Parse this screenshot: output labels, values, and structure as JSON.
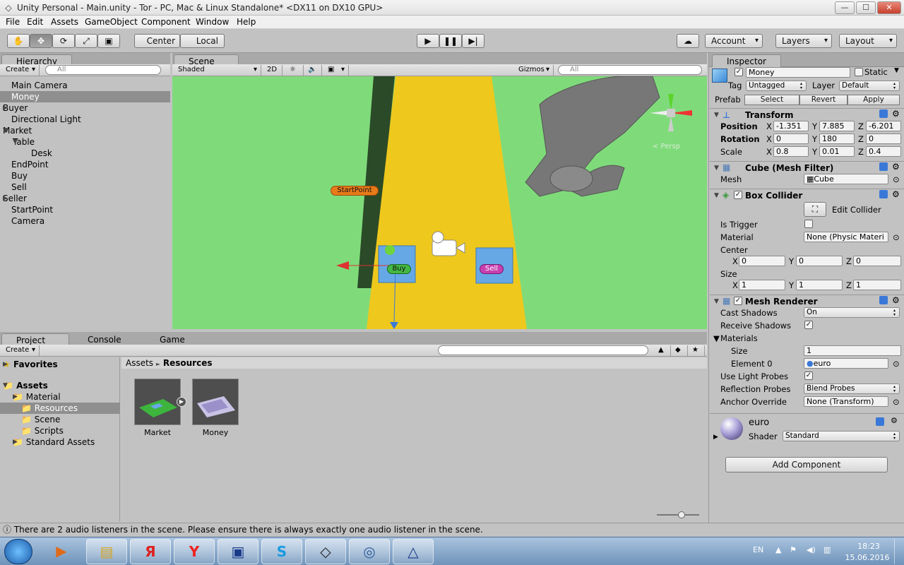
{
  "window": {
    "title": "Unity Personal - Main.unity - Tor - PC, Mac & Linux Standalone* <DX11 on DX10 GPU>",
    "min": "—",
    "max": "☐",
    "close": "✕"
  },
  "menu": [
    "File",
    "Edit",
    "Assets",
    "GameObject",
    "Component",
    "Window",
    "Help"
  ],
  "toolbar": {
    "pivot": "Center",
    "space": "Local",
    "account": "Account",
    "layers": "Layers",
    "layout": "Layout",
    "cloud": "☁"
  },
  "hierarchy": {
    "tab": "Hierarchy",
    "create": "Create",
    "search": "All",
    "items": [
      "Main Camera",
      "Money",
      "Buyer",
      "Directional Light",
      "Market",
      "Table",
      "Desk",
      "EndPoint",
      "Buy",
      "Sell",
      "Seller",
      "StartPoint",
      "Camera"
    ]
  },
  "scene": {
    "tab": "Scene",
    "shading": "Shaded",
    "mode2d": "2D",
    "gizmos": "Gizmos",
    "search": "All",
    "labels": {
      "start": "StartPoint",
      "buy": "Buy",
      "sell": "Sell",
      "persp": "< Persp"
    }
  },
  "project": {
    "tab": "Project",
    "console": "Console",
    "game": "Game",
    "create": "Create",
    "favorites": "Favorites",
    "assets": "Assets",
    "folders": [
      "Material",
      "Resources",
      "Scene",
      "Scripts",
      "Standard Assets"
    ],
    "breadcrumb": {
      "root": "Assets",
      "sep": "►",
      "current": "Resources"
    },
    "items": [
      "Market",
      "Money"
    ]
  },
  "inspector": {
    "tab": "Inspector",
    "name": "Money",
    "static": "Static",
    "tag_label": "Tag",
    "tag": "Untagged",
    "layer_label": "Layer",
    "layer": "Default",
    "prefab": "Prefab",
    "select": "Select",
    "revert": "Revert",
    "apply": "Apply",
    "transform": {
      "title": "Transform",
      "pos": "Position",
      "rot": "Rotation",
      "scale": "Scale",
      "pos_x": "-1.351",
      "pos_y": "7.885",
      "pos_z": "-6.201",
      "rot_x": "0",
      "rot_y": "180",
      "rot_z": "0",
      "sc_x": "0.8",
      "sc_y": "0.01",
      "sc_z": "0.4"
    },
    "meshfilter": {
      "title": "Cube (Mesh Filter)",
      "mesh_label": "Mesh",
      "mesh": "Cube"
    },
    "collider": {
      "title": "Box Collider",
      "edit": "Edit Collider",
      "trigger": "Is Trigger",
      "material": "Material",
      "material_val": "None (Physic Materi",
      "center": "Center",
      "size": "Size",
      "c_x": "0",
      "c_y": "0",
      "c_z": "0",
      "s_x": "1",
      "s_y": "1",
      "s_z": "1"
    },
    "renderer": {
      "title": "Mesh Renderer",
      "cast": "Cast Shadows",
      "cast_val": "On",
      "receive": "Receive Shadows",
      "materials": "Materials",
      "size": "Size",
      "size_val": "1",
      "element": "Element 0",
      "element_val": "euro",
      "probes": "Use Light Probes",
      "refl": "Reflection Probes",
      "refl_val": "Blend Probes",
      "anchor": "Anchor Override",
      "anchor_val": "None (Transform)"
    },
    "material": {
      "name": "euro",
      "shader_label": "Shader",
      "shader": "Standard"
    },
    "add": "Add Component"
  },
  "status": "There are 2 audio listeners in the scene. Please ensure there is always exactly one audio listener in the scene.",
  "tray": {
    "lang": "EN",
    "time": "18:23",
    "date": "15.06.2016"
  }
}
